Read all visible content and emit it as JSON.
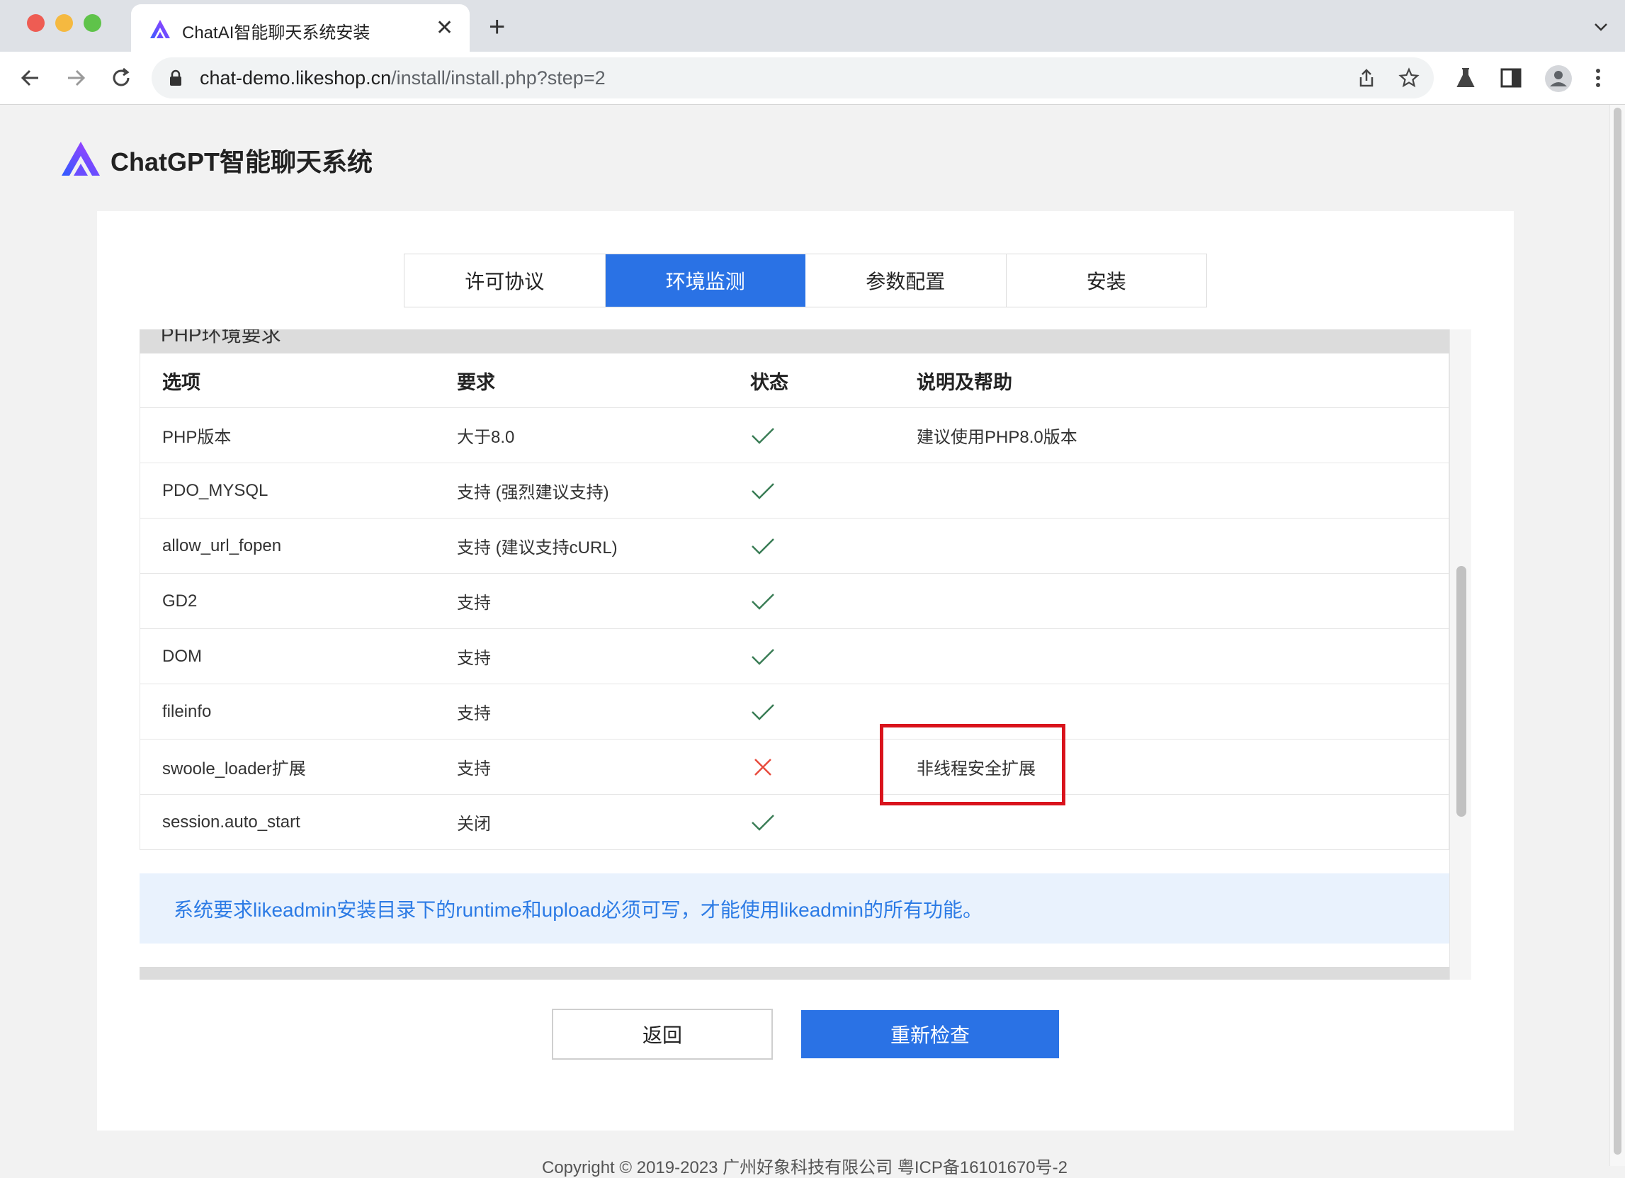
{
  "browser": {
    "tab_title": "ChatAI智能聊天系统安装",
    "url_host": "chat-demo.likeshop.cn",
    "url_path": "/install/install.php?step=2"
  },
  "header": {
    "brand": "ChatGPT智能聊天系统"
  },
  "steps": [
    {
      "label": "许可协议",
      "active": false
    },
    {
      "label": "环境监测",
      "active": true
    },
    {
      "label": "参数配置",
      "active": false
    },
    {
      "label": "安装",
      "active": false
    }
  ],
  "section": {
    "title": "PHP环境要求"
  },
  "table": {
    "headers": [
      "选项",
      "要求",
      "状态",
      "说明及帮助"
    ],
    "rows": [
      {
        "option": "PHP版本",
        "requirement": "大于8.0",
        "status": "pass",
        "help": "建议使用PHP8.0版本"
      },
      {
        "option": "PDO_MYSQL",
        "requirement": "支持 (强烈建议支持)",
        "status": "pass",
        "help": ""
      },
      {
        "option": "allow_url_fopen",
        "requirement": "支持 (建议支持cURL)",
        "status": "pass",
        "help": ""
      },
      {
        "option": "GD2",
        "requirement": "支持",
        "status": "pass",
        "help": ""
      },
      {
        "option": "DOM",
        "requirement": "支持",
        "status": "pass",
        "help": ""
      },
      {
        "option": "fileinfo",
        "requirement": "支持",
        "status": "pass",
        "help": ""
      },
      {
        "option": "swoole_loader扩展",
        "requirement": "支持",
        "status": "fail",
        "help": "非线程安全扩展"
      },
      {
        "option": "session.auto_start",
        "requirement": "关闭",
        "status": "pass",
        "help": ""
      }
    ]
  },
  "alert": {
    "text": "系统要求likeadmin安装目录下的runtime和upload必须可写，才能使用likeadmin的所有功能。"
  },
  "actions": {
    "back": "返回",
    "recheck": "重新检查"
  },
  "footer": {
    "text": "Copyright © 2019-2023 广州好象科技有限公司 粤ICP备16101670号-2"
  },
  "colors": {
    "primary": "#2a72e5",
    "pass": "#3a7d56",
    "fail": "#e84a3c",
    "highlight": "#d9131c",
    "alert_bg": "#e9f2fd",
    "alert_text": "#2c7be5"
  }
}
